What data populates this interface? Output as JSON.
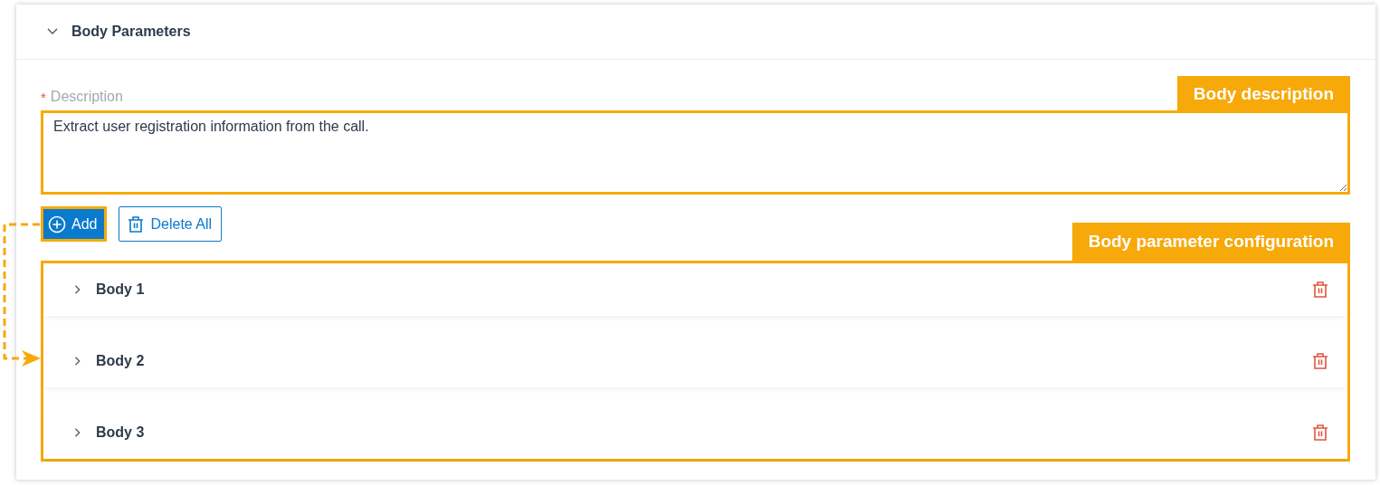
{
  "section": {
    "title": "Body Parameters",
    "expanded": true
  },
  "description": {
    "label": "Description",
    "required_mark": "*",
    "value": "Extract user registration information from the call."
  },
  "buttons": [
    {
      "label": "Add",
      "kind": "primary"
    },
    {
      "label": "Delete All",
      "kind": "outline"
    }
  ],
  "bodies": [
    {
      "title": "Body 1",
      "expanded": false
    },
    {
      "title": "Body 2",
      "expanded": false
    },
    {
      "title": "Body 3",
      "expanded": false
    }
  ],
  "callouts": {
    "description": "Body description",
    "bodies": "Body parameter configuration"
  }
}
